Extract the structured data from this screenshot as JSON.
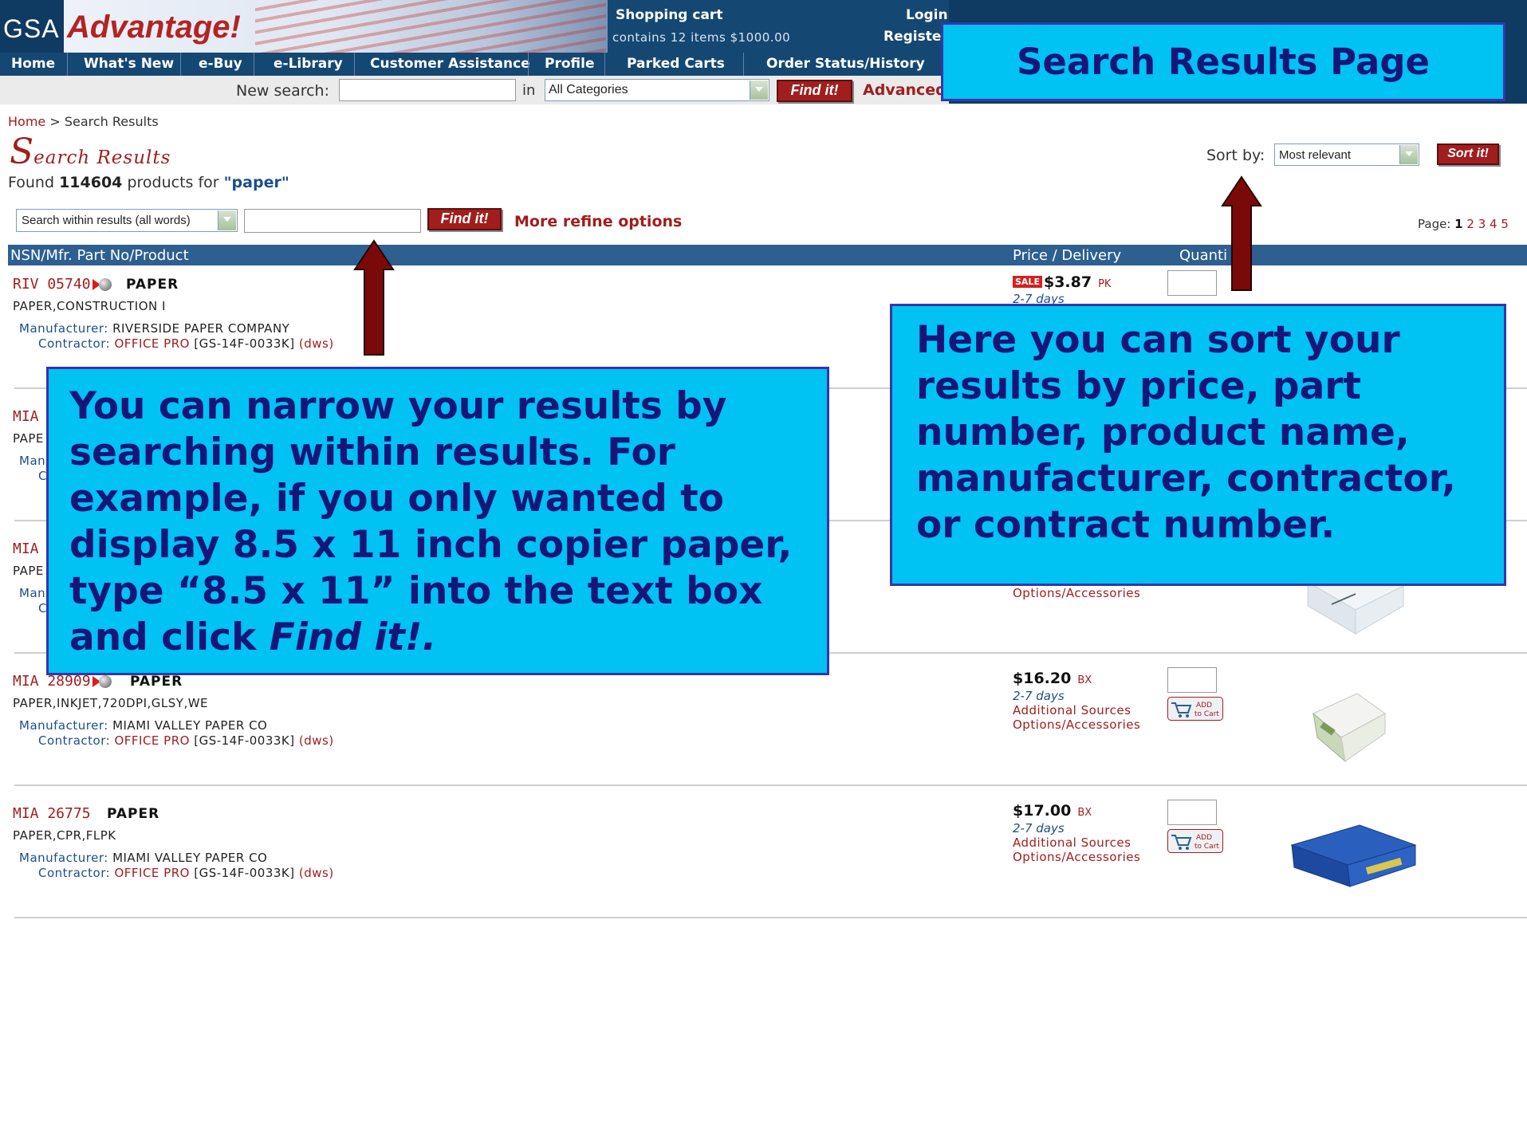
{
  "header": {
    "logo_gsa": "GSA",
    "logo_advantage": "Advantage!",
    "cart_title": "Shopping cart",
    "cart_summary": "contains 12 items $1000.00",
    "login": "Login",
    "register": "Register"
  },
  "nav": {
    "items": [
      "Home",
      "What's New",
      "e-Buy",
      "e-Library",
      "Customer Assistance",
      "Profile",
      "Parked Carts",
      "Order Status/History"
    ]
  },
  "search": {
    "label": "New search:",
    "in_label": "in",
    "category": "All Categories",
    "find_label": "Find it!",
    "advanced_label": "Advanced"
  },
  "breadcrumb": {
    "home": "Home",
    "sep": ">",
    "current": "Search Results"
  },
  "results": {
    "title_initial": "S",
    "title_rest": "earch Results",
    "found_prefix": "Found",
    "count": "114604",
    "found_mid": "products for",
    "query": "\"paper\"",
    "sort_label": "Sort by:",
    "sort_value": "Most relevant",
    "sort_button": "Sort it!",
    "within_select": "Search within results (all words)",
    "within_find": "Find it!",
    "refine_label": "More refine options",
    "pages_label": "Page:",
    "pages": [
      "1",
      "2",
      "3",
      "4",
      "5"
    ]
  },
  "table": {
    "col_product": "NSN/Mfr. Part No/Product",
    "col_price": "Price / Delivery",
    "col_qty": "Quanti"
  },
  "rows": [
    {
      "part": "RIV 05740",
      "name": "PAPER",
      "desc": "PAPER,CONSTRUCTION I",
      "mfr_label": "Manufacturer:",
      "mfr": "RIVERSIDE PAPER COMPANY",
      "ctr_label": "Contractor:",
      "ctr": "OFFICE PRO",
      "contract": "[GS-14F-0033K]",
      "dws": "(dws)",
      "sale": "SALE",
      "price": "$3.87",
      "unit": "PK",
      "days": "2-7 days"
    },
    {
      "part": "MIA",
      "desc": "PAPE",
      "mfr_label": "Man",
      "ctr_label": "C"
    },
    {
      "part": "MIA",
      "desc": "PAPE",
      "mfr_label": "Man",
      "ctr_label": "C",
      "options": "Options/Accessories"
    },
    {
      "part": "MIA 28909",
      "name": "PAPER",
      "desc": "PAPER,INKJET,720DPI,GLSY,WE",
      "mfr_label": "Manufacturer:",
      "mfr": "MIAMI VALLEY PAPER CO",
      "ctr_label": "Contractor:",
      "ctr": "OFFICE PRO",
      "contract": "[GS-14F-0033K]",
      "dws": "(dws)",
      "price": "$16.20",
      "unit": "BX",
      "days": "2-7 days",
      "sources": "Additional Sources",
      "options": "Options/Accessories"
    },
    {
      "part": "MIA 26775",
      "name": "PAPER",
      "desc": "PAPER,CPR,FLPK",
      "mfr_label": "Manufacturer:",
      "mfr": "MIAMI VALLEY PAPER CO",
      "ctr_label": "Contractor:",
      "ctr": "OFFICE PRO",
      "contract": "[GS-14F-0033K]",
      "dws": "(dws)",
      "price": "$17.00",
      "unit": "BX",
      "days": "2-7 days",
      "sources": "Additional Sources",
      "options": "Options/Accessories"
    }
  ],
  "add_to_cart": {
    "line1": "ADD",
    "line2": "to Cart"
  },
  "callouts": {
    "title": "Search Results Page",
    "sort_text": "Here you can sort your results by price, part number, product name, manufacturer, contractor, or contract number.",
    "narrow_text": "You can narrow your results by searching within results.  For example, if you only wanted to display 8.5 x 11 inch copier paper, type “8.5 x 11” into the text box and click",
    "narrow_emph": "Find it!."
  },
  "colors": {
    "header_blue": "#0f3a62",
    "accent_red": "#a01e1e",
    "callout_fill": "#00c2f3",
    "callout_text": "#16167a",
    "arrow": "#7a0a0a"
  }
}
